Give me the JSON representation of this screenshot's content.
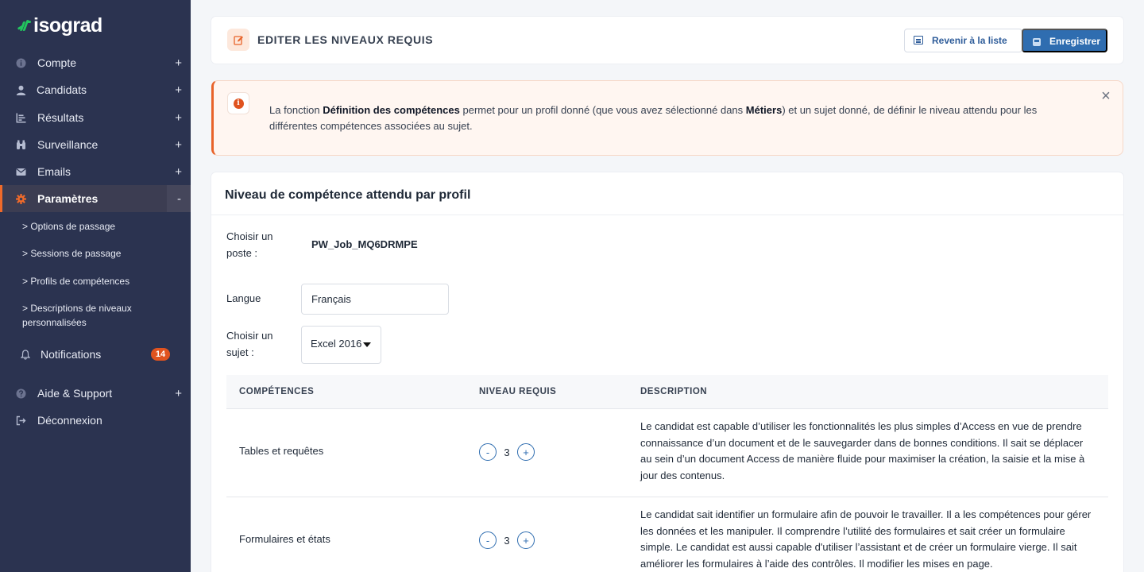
{
  "brand": {
    "name": "isograd"
  },
  "sidebar": {
    "items": [
      {
        "label": "Compte",
        "toggle": "+",
        "icon": "info-circle-icon"
      },
      {
        "label": "Candidats",
        "toggle": "+",
        "icon": "user-icon"
      },
      {
        "label": "Résultats",
        "toggle": "+",
        "icon": "list-chart-icon"
      },
      {
        "label": "Surveillance",
        "toggle": "+",
        "icon": "binoculars-icon"
      },
      {
        "label": "Emails",
        "toggle": "+",
        "icon": "envelope-icon"
      },
      {
        "label": "Paramètres",
        "toggle": "-",
        "icon": "gear-icon"
      }
    ],
    "subitems": [
      "> Options de passage",
      "> Sessions de passage",
      "> Profils de compétences",
      "> Descriptions de niveaux personnalisées"
    ],
    "notifications": {
      "label": "Notifications",
      "count": "14"
    },
    "support": {
      "label": "Aide & Support",
      "toggle": "+"
    },
    "logout": {
      "label": "Déconnexion"
    }
  },
  "header": {
    "title": "EDITER LES NIVEAUX REQUIS",
    "back_label": "Revenir à la liste",
    "save_label": "Enregistrer"
  },
  "alert": {
    "part1": "La fonction ",
    "bold1": "Définition des compétences",
    "part2": " permet pour un profil donné (que vous avez sélectionné dans ",
    "bold2": "Métiers",
    "part3": ") et un sujet donné, de définir le niveau attendu pour les différentes compétences associées au sujet.",
    "close": "×"
  },
  "main": {
    "title": "Niveau de compétence attendu par profil",
    "post_label": "Choisir un poste :",
    "post_value": "PW_Job_MQ6DRMPE",
    "language_label": "Langue",
    "language_value": "Français",
    "subject_label": "Choisir un sujet :",
    "subject_value": "Excel 2016"
  },
  "table": {
    "headers": [
      "COMPÉTENCES",
      "NIVEAU REQUIS",
      "DESCRIPTION"
    ],
    "rows": [
      {
        "competence": "Tables et requêtes",
        "level": "3",
        "description": "Le candidat est capable d’utiliser les fonctionnalités les plus simples d’Access en vue de prendre connaissance d’un document et de le sauvegarder dans de bonnes conditions. Il sait se déplacer au sein d’un document Access de manière fluide pour maximiser la création, la saisie et la mise à jour des contenus."
      },
      {
        "competence": "Formulaires et états",
        "level": "3",
        "description": "Le candidat sait identifier un formulaire afin de pouvoir le travailler. Il a les compétences pour gérer les données et les manipuler. Il comprendre l’utilité des formulaires  et sait créer un formulaire simple. Le candidat est aussi capable d'utiliser l’assistant et de créer un formulaire vierge. Il sait améliorer les formulaires à l’aide des contrôles. Il modifier les mises en page."
      }
    ],
    "minus": "-",
    "plus": "+"
  }
}
